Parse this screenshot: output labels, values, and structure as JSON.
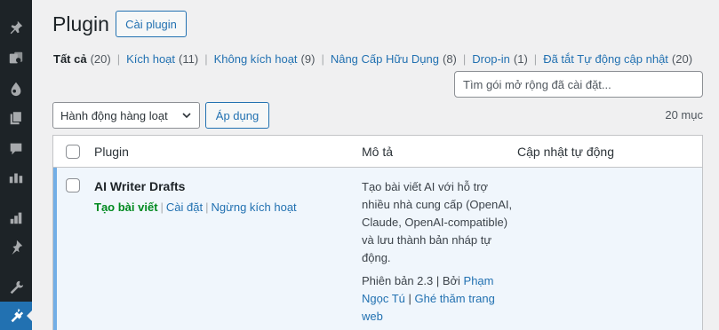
{
  "page": {
    "title": "Plugin",
    "add_button": "Cài plugin"
  },
  "filters": [
    {
      "label": "Tất cả",
      "count": "(20)",
      "current": true
    },
    {
      "label": "Kích hoạt",
      "count": "(11)"
    },
    {
      "label": "Không kích hoạt",
      "count": "(9)"
    },
    {
      "label": "Nâng Cấp Hữu Dụng",
      "count": "(8)"
    },
    {
      "label": "Drop-in",
      "count": "(1)"
    },
    {
      "label": "Đã tắt Tự động cập nhật",
      "count": "(20)"
    }
  ],
  "filter_separator": "|",
  "search": {
    "placeholder": "Tìm gói mở rộng đã cài đặt..."
  },
  "bulk": {
    "selected": "Hành động hàng loạt",
    "apply_label": "Áp dụng",
    "item_count": "20 mục"
  },
  "table": {
    "col_plugin": "Plugin",
    "col_desc": "Mô tả",
    "col_auto": "Cập nhật tự động"
  },
  "plugin": {
    "name": "AI Writer Drafts",
    "action_primary": "Tạo bài viết",
    "action_settings": "Cài đặt",
    "action_deactivate": "Ngừng kích hoạt",
    "description": "Tạo bài viết AI với hỗ trợ nhiều nhà cung cấp (OpenAI, Claude, OpenAI-compatible) và lưu thành bản nháp tự động.",
    "version_text": "Phiên bản 2.3 | Bởi ",
    "author": "Phạm Ngọc Tú",
    "meta_sep": " | ",
    "visit": "Ghé thăm trang web"
  },
  "sidebar_icons": [
    "pin-icon",
    "media-icon",
    "drop-icon",
    "pages-icon",
    "comments-icon",
    "sync-icon",
    "chart-icon",
    "pushpin-icon",
    "tools-icon",
    "plugins-icon"
  ],
  "colors": {
    "accent": "#2271b1",
    "sidebar": "#1d2327",
    "active_row_border": "#72aee6",
    "active_row_bg": "#f0f6fc",
    "action_green": "#008a20"
  }
}
